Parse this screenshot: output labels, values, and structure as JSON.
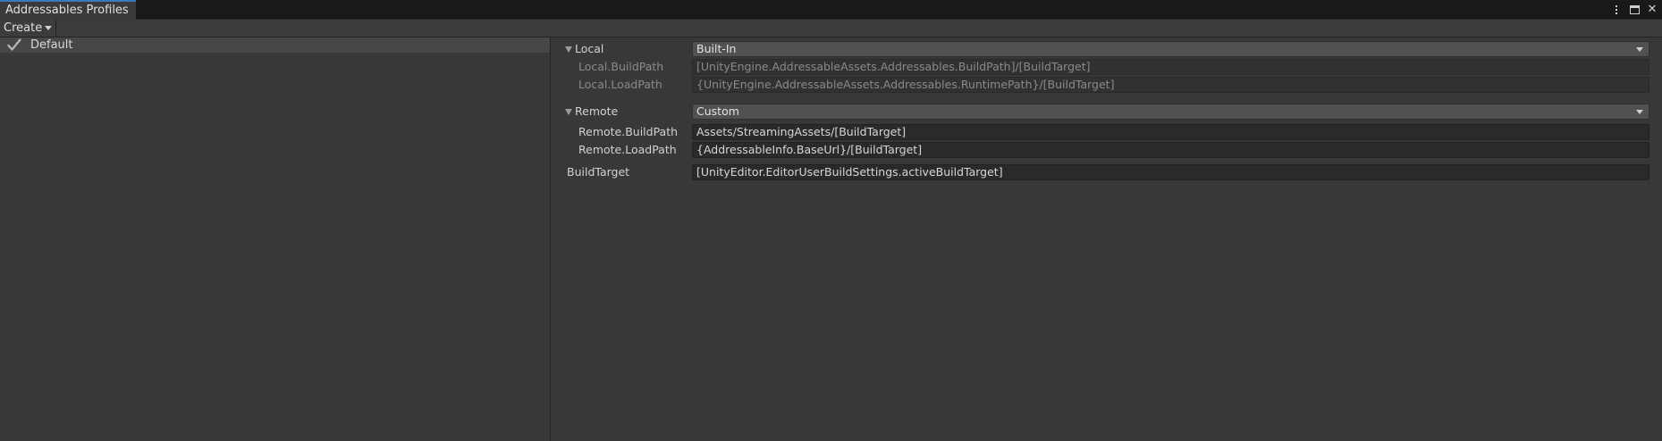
{
  "window": {
    "tab_title": "Addressables Profiles",
    "tools": {
      "menu_icon": "kebab-menu-icon",
      "maximize_icon": "maximize-icon",
      "close_glyph": "✕"
    }
  },
  "toolbar": {
    "create_label": "Create"
  },
  "profiles": [
    {
      "name": "Default",
      "active": true
    }
  ],
  "settings": {
    "local": {
      "group_label": "Local",
      "type_value": "Built-In",
      "build_path_label": "Local.BuildPath",
      "build_path_value": "[UnityEngine.AddressableAssets.Addressables.BuildPath]/[BuildTarget]",
      "load_path_label": "Local.LoadPath",
      "load_path_value": "{UnityEngine.AddressableAssets.Addressables.RuntimePath}/[BuildTarget]"
    },
    "remote": {
      "group_label": "Remote",
      "type_value": "Custom",
      "build_path_label": "Remote.BuildPath",
      "build_path_value": "Assets/StreamingAssets/[BuildTarget]",
      "load_path_label": "Remote.LoadPath",
      "load_path_value": "{AddressableInfo.BaseUrl}/[BuildTarget]"
    },
    "build_target": {
      "label": "BuildTarget",
      "value": "[UnityEditor.EditorUserBuildSettings.activeBuildTarget]"
    }
  },
  "colors": {
    "accent": "#3a79bb",
    "background": "#383838",
    "selected_row": "#474747"
  }
}
